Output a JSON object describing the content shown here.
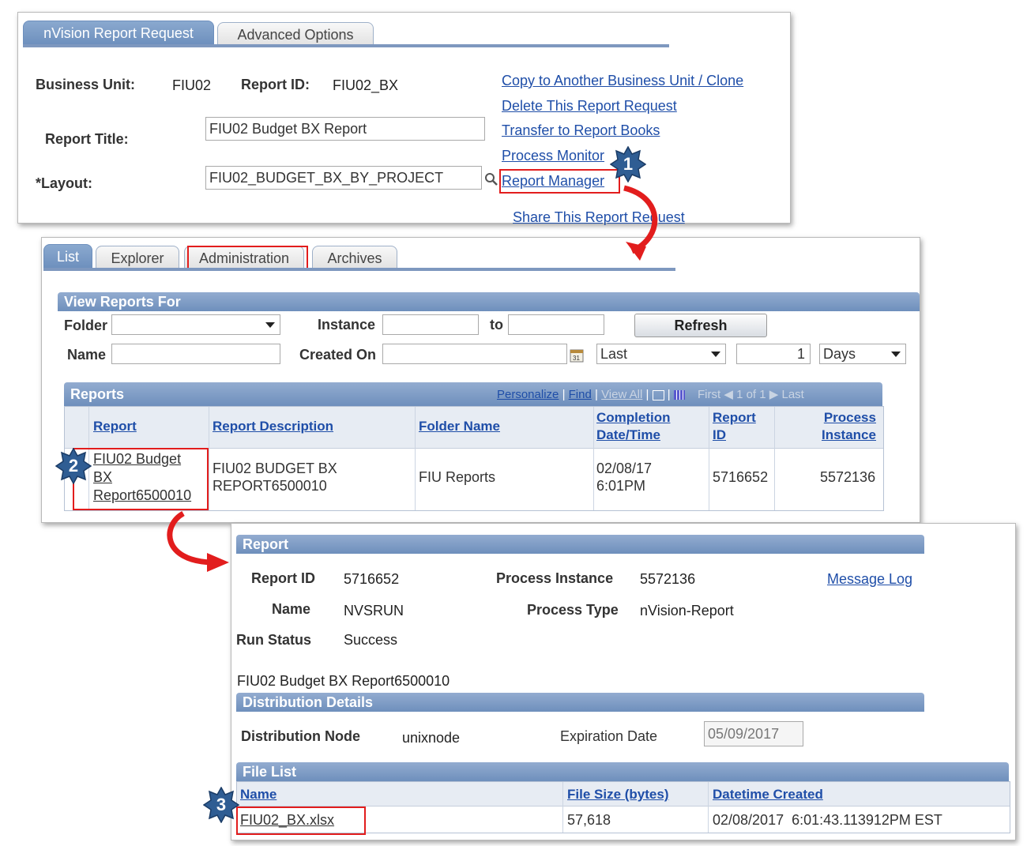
{
  "panel1": {
    "tabs": [
      "nVision Report Request",
      "Advanced Options"
    ],
    "business_unit_label": "Business Unit:",
    "business_unit_value": "FIU02",
    "report_id_label": "Report ID:",
    "report_id_value": "FIU02_BX",
    "report_title_label": "Report Title:",
    "report_title_value": "FIU02 Budget BX Report",
    "layout_label": "*Layout:",
    "layout_value": "FIU02_BUDGET_BX_BY_PROJECT",
    "links": [
      "Copy to Another Business Unit / Clone",
      "Delete This Report Request",
      "Transfer to Report Books",
      "Process Monitor",
      "Report Manager",
      "Share This Report Request"
    ]
  },
  "panel2": {
    "tabs": [
      "List",
      "Explorer",
      "Administration",
      "Archives"
    ],
    "view_section": "View Reports For",
    "folder_label": "Folder",
    "instance_label": "Instance",
    "to_label": "to",
    "refresh_label": "Refresh",
    "name_label": "Name",
    "created_on_label": "Created On",
    "last_value": "Last",
    "days_count": "1",
    "days_value": "Days",
    "reports_section": "Reports",
    "nav": {
      "personalize": "Personalize",
      "find": "Find",
      "view_all": "View All",
      "first": "First",
      "page": "1 of 1",
      "last": "Last"
    },
    "columns": [
      "Report",
      "Report Description",
      "Folder Name",
      "Completion Date/Time",
      "Report ID",
      "Process Instance"
    ],
    "columns_split": {
      "completion1": "Completion",
      "completion2": "Date/Time",
      "rid1": "Report",
      "rid2": "ID",
      "proc1": "Process",
      "proc2": "Instance"
    },
    "row": {
      "report_line1": "FIU02 Budget",
      "report_line2": "BX",
      "report_line3": "Report6500010",
      "desc_line1": "FIU02 BUDGET BX",
      "desc_line2": "REPORT6500010",
      "folder": "FIU Reports",
      "date_line1": "02/08/17",
      "date_line2": "6:01PM",
      "report_id": "5716652",
      "process_instance": "5572136"
    }
  },
  "panel3": {
    "report_section": "Report",
    "report_id_label": "Report ID",
    "report_id_value": "5716652",
    "process_instance_label": "Process Instance",
    "process_instance_value": "5572136",
    "message_log": "Message Log",
    "name_label": "Name",
    "name_value": "NVSRUN",
    "process_type_label": "Process Type",
    "process_type_value": "nVision-Report",
    "run_status_label": "Run Status",
    "run_status_value": "Success",
    "report_name": "FIU02 Budget BX Report6500010",
    "distribution_section": "Distribution Details",
    "distribution_node_label": "Distribution Node",
    "distribution_node_value": "unixnode",
    "expiration_label": "Expiration Date",
    "expiration_value": "05/09/2017",
    "file_list_section": "File List",
    "file_columns": [
      "Name",
      "File Size (bytes)",
      "Datetime Created"
    ],
    "file": {
      "name": "FIU02_BX.xlsx",
      "size": "57,618",
      "created": "02/08/2017  6:01:43.113912PM EST"
    }
  },
  "steps": [
    "1",
    "2",
    "3"
  ],
  "colors": {
    "accent": "#6e8fbc",
    "link": "#1f4ea8",
    "highlight": "#e21d1d",
    "badge": "#2f5d93"
  }
}
